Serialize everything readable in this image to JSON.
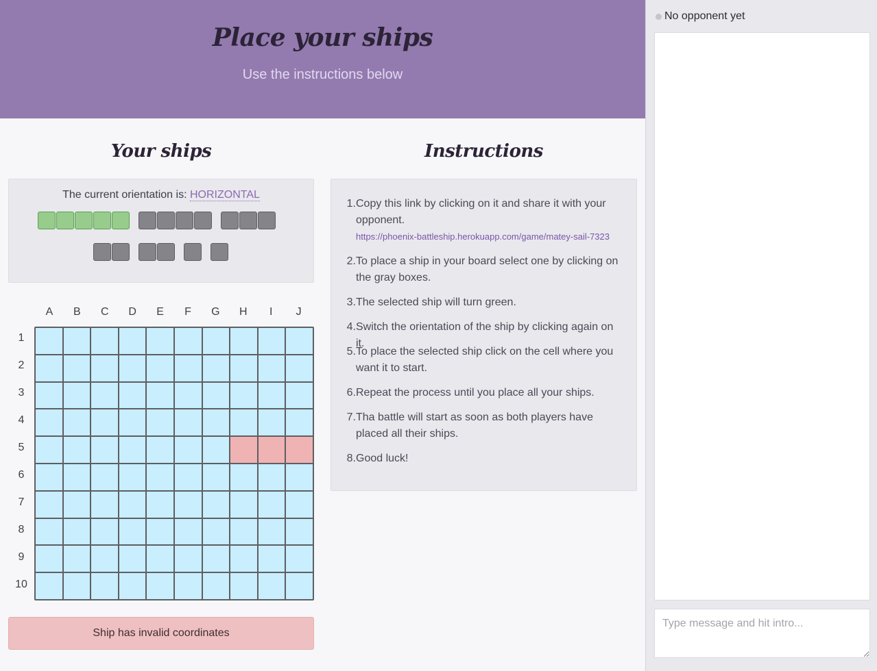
{
  "header": {
    "title": "Place your ships",
    "subtitle": "Use the instructions below"
  },
  "ships_panel": {
    "title": "Your ships",
    "orientation_label": "The current orientation is:",
    "orientation_value": "HORIZONTAL",
    "ships": [
      {
        "size": 5,
        "selected": true
      },
      {
        "size": 4,
        "selected": false
      },
      {
        "size": 3,
        "selected": false
      },
      {
        "size": 2,
        "selected": false
      },
      {
        "size": 2,
        "selected": false
      },
      {
        "size": 1,
        "selected": false
      },
      {
        "size": 1,
        "selected": false
      }
    ],
    "ship_colors": {
      "selected": "#97cc8d",
      "unplaced": "#858488"
    }
  },
  "board": {
    "columns": [
      "A",
      "B",
      "C",
      "D",
      "E",
      "F",
      "G",
      "H",
      "I",
      "J"
    ],
    "rows": [
      "1",
      "2",
      "3",
      "4",
      "5",
      "6",
      "7",
      "8",
      "9",
      "10"
    ],
    "invalid_cells": [
      "H5",
      "I5",
      "J5"
    ],
    "colors": {
      "water": "#c9eefd",
      "invalid": "#efb3b3"
    }
  },
  "alert": {
    "text": "Ship has invalid coordinates"
  },
  "instructions": {
    "title": "Instructions",
    "link": "https://phoenix-battleship.herokuapp.com/game/matey-sail-7323",
    "items": [
      {
        "num": "1.",
        "text": "Copy this link by clicking on it and share it with your opponent."
      },
      {
        "num": "2.",
        "text": "To place a ship in your board select one by clicking on the gray boxes."
      },
      {
        "num": "3.",
        "text": "The selected ship will turn green."
      },
      {
        "num": "4.",
        "text": "Switch the orientation of the ship by clicking again on it."
      },
      {
        "num": "5.",
        "text": "To place the selected ship click on the cell where you want it to start."
      },
      {
        "num": "6.",
        "text": "Repeat the process until you place all your ships."
      },
      {
        "num": "7.",
        "text": "Tha battle will start as soon as both players have placed all their ships."
      },
      {
        "num": "8.",
        "text": "Good luck!"
      }
    ]
  },
  "sidebar": {
    "status": "No opponent yet",
    "message_placeholder": "Type message and hit intro..."
  },
  "colors": {
    "header_bg": "#937bb0",
    "accent": "#8b6bb0"
  }
}
